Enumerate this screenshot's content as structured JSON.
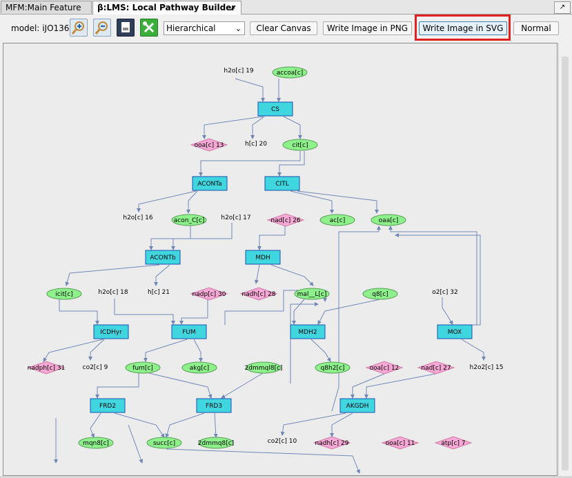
{
  "tabs": [
    {
      "label": "MFM:Main Feature Map"
    },
    {
      "label": "β:LMS: Local Pathway Builder"
    }
  ],
  "toolbar": {
    "model_label": "model: iJO1366",
    "layout_select": "Hierarchical",
    "clear_label": "Clear Canvas",
    "png_label": "Write Image in PNG",
    "svg_label": "Write Image in SVG",
    "normal_label": "Normal"
  },
  "icons": [
    "zoom-in-icon",
    "zoom-out-icon",
    "save-image-icon",
    "tools-icon",
    "pin-icon",
    "chevron-down-icon"
  ],
  "colors": {
    "reaction": "#3fd6e0",
    "metabolite": "#8ef08a",
    "cofactor": "#f7a8d4",
    "edge": "#7088b8",
    "highlight": "#e32020"
  },
  "graph": {
    "reactions": [
      {
        "id": "CS",
        "label": "CS"
      },
      {
        "id": "ACONTa",
        "label": "ACONTa"
      },
      {
        "id": "CITL",
        "label": "CITL"
      },
      {
        "id": "ACONTb",
        "label": "ACONTb"
      },
      {
        "id": "MDH",
        "label": "MDH"
      },
      {
        "id": "ICDHyr",
        "label": "ICDHyr"
      },
      {
        "id": "FUM",
        "label": "FUM"
      },
      {
        "id": "MDH2",
        "label": "MDH2"
      },
      {
        "id": "MOX",
        "label": "MOX"
      },
      {
        "id": "FRD2",
        "label": "FRD2"
      },
      {
        "id": "FRD3",
        "label": "FRD3"
      },
      {
        "id": "AKGDH",
        "label": "AKGDH"
      }
    ],
    "metabolites": [
      {
        "label": "accoa[c]"
      },
      {
        "label": "cit[c]"
      },
      {
        "label": "acon_C[c]"
      },
      {
        "label": "ac[c]"
      },
      {
        "label": "oaa[c]"
      },
      {
        "label": "icit[c]"
      },
      {
        "label": "mal__L[c]"
      },
      {
        "label": "q8[c]"
      },
      {
        "label": "fum[c]"
      },
      {
        "label": "akg[c]"
      },
      {
        "label": "2dmmql8[c]"
      },
      {
        "label": "q8h2[c]"
      },
      {
        "label": "mqn8[c]"
      },
      {
        "label": "succ[c]"
      },
      {
        "label": "2dmmq8[c]"
      }
    ],
    "cofactors": [
      {
        "label": "ooa[c] 13"
      },
      {
        "label": "nad[c] 26"
      },
      {
        "label": "nadp[c] 30"
      },
      {
        "label": "nadh[c] 28"
      },
      {
        "label": "nadph[c] 31"
      },
      {
        "label": "ooa[c] 12"
      },
      {
        "label": "nad[c] 27"
      },
      {
        "label": "nadh[c] 29"
      },
      {
        "label": "ooa[c] 11"
      },
      {
        "label": "atp[c] 7"
      }
    ],
    "plain": [
      {
        "label": "h2o[c] 19"
      },
      {
        "label": "h[c] 20"
      },
      {
        "label": "h2o[c] 16"
      },
      {
        "label": "h2o[c] 17"
      },
      {
        "label": "h2o[c] 18"
      },
      {
        "label": "h[c] 21"
      },
      {
        "label": "o2[c] 32"
      },
      {
        "label": "co2[c] 9"
      },
      {
        "label": "h2o2[c] 15"
      },
      {
        "label": "co2[c] 10"
      }
    ]
  }
}
